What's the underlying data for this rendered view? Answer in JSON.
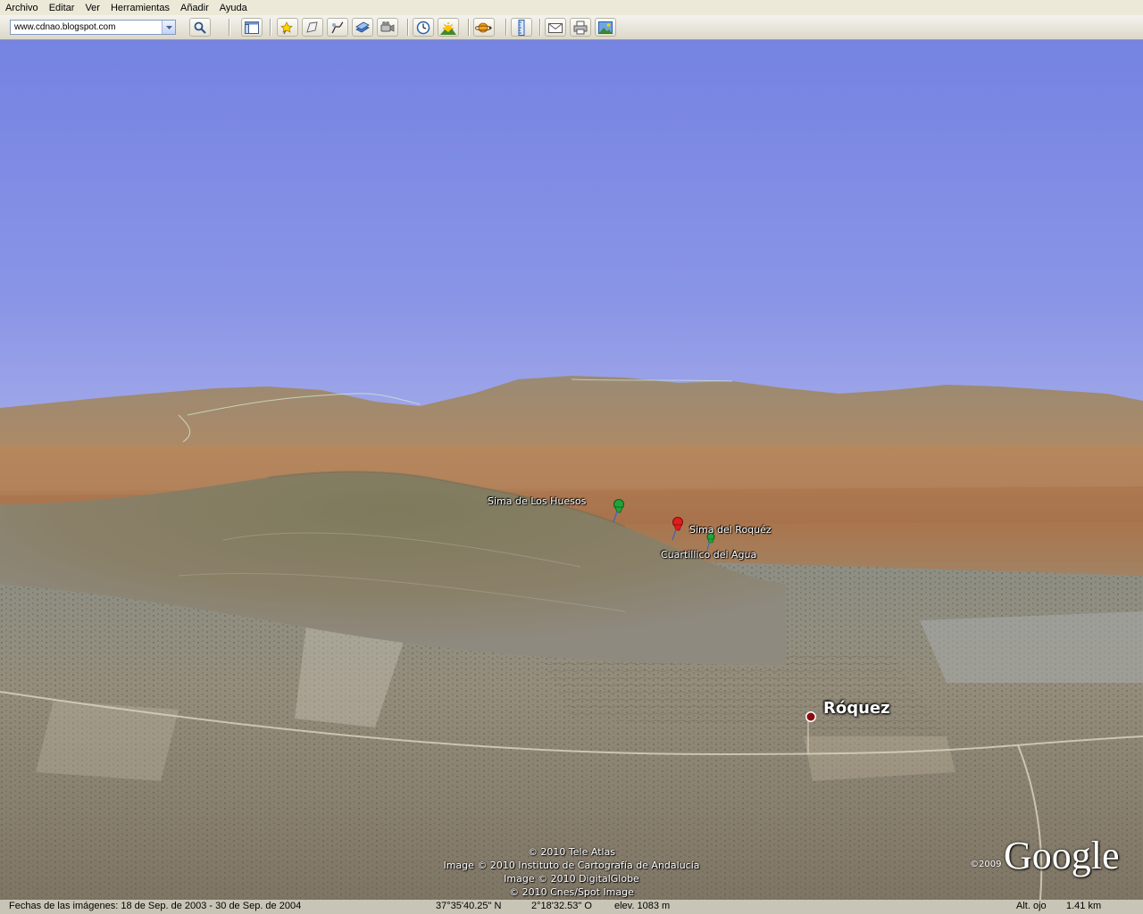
{
  "menu": {
    "items": [
      "Archivo",
      "Editar",
      "Ver",
      "Herramientas",
      "Añadir",
      "Ayuda"
    ]
  },
  "toolbar": {
    "search_value": "www.cdnao.blogspot.com",
    "buttons": [
      "search-icon",
      "sidebar-toggle-icon",
      "placemark-icon",
      "polygon-icon",
      "path-icon",
      "image-overlay-icon",
      "record-tour-icon",
      "historical-imagery-icon",
      "sunlight-icon",
      "planets-icon",
      "ruler-icon",
      "email-icon",
      "print-icon",
      "save-image-icon"
    ]
  },
  "map": {
    "placemarks": [
      {
        "label": "Sima de Los Huesos",
        "color": "#21a33c"
      },
      {
        "label": "Sima del Roquéz",
        "color": "#e21b1b"
      },
      {
        "label": "Cuartillico del Agua",
        "color": "#21a33c"
      }
    ],
    "place_label": "Róquez",
    "credits": [
      "© 2010 Tele Atlas",
      "Image © 2010 Instituto de Cartografía de Andalucía",
      "Image © 2010 DigitalGlobe",
      "© 2010 Cnes/Spot Image"
    ],
    "logo": "Google",
    "logo_year": "©2009"
  },
  "status": {
    "imagery_dates": "Fechas de las imágenes: 18 de Sep. de 2003 - 30 de Sep. de 2004",
    "latitude": "37°35'40.25\" N",
    "longitude": "2°18'32.53\" O",
    "elevation": "elev. 1083 m",
    "eye_alt_label": "Alt. ojo",
    "eye_alt_value": "1.41 km"
  }
}
